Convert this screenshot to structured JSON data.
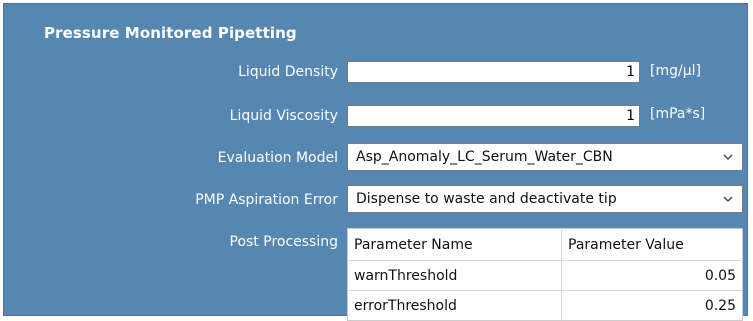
{
  "section": {
    "title": "Pressure Monitored Pipetting"
  },
  "liquid_density": {
    "label": "Liquid Density",
    "value": "1",
    "unit": "[mg/µl]"
  },
  "liquid_viscosity": {
    "label": "Liquid Viscosity",
    "value": "1",
    "unit": "[mPa*s]"
  },
  "evaluation_model": {
    "label": "Evaluation Model",
    "selected": "Asp_Anomaly_LC_Serum_Water_CBN"
  },
  "pmp_aspiration_error": {
    "label": "PMP Aspiration Error",
    "selected": "Dispense to waste and deactivate tip"
  },
  "post_processing": {
    "label": "Post Processing",
    "columns": [
      "Parameter Name",
      "Parameter Value"
    ],
    "rows": [
      {
        "name": "warnThreshold",
        "value": "0.05"
      },
      {
        "name": "errorThreshold",
        "value": "0.25"
      }
    ]
  },
  "colors": {
    "panel_background": "#5687b3",
    "label_text": "#ffffff"
  },
  "icons": {
    "dropdown": "chevron-down-icon"
  }
}
